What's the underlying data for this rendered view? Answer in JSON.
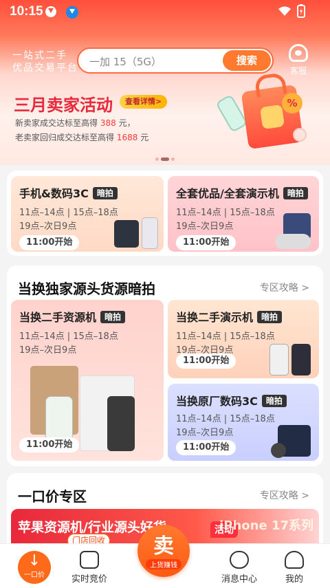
{
  "status_bar": {
    "time": "10:15"
  },
  "header": {
    "slogan_line1": "一站式二手",
    "slogan_line2": "优品交易平台",
    "search_value": "一加 15（5G）",
    "search_button": "搜索",
    "service_label": "客服"
  },
  "promo": {
    "title": "三月卖家活动",
    "detail_button": "查看详情>",
    "line1_prefix": "新卖家成交达标至高得",
    "line1_amount": "388",
    "line1_unit": "元，",
    "line2_prefix": "老卖家回归成交达标至高得",
    "line2_amount": "1688",
    "line2_unit": "元"
  },
  "auction_tiles": [
    {
      "title": "手机&数码3C",
      "tag": "暗拍",
      "time1": "11点–14点 | 15点–18点",
      "time2": "19点–次日9点",
      "start": "11:00开始"
    },
    {
      "title": "全套优品/全套演示机",
      "tag": "暗拍",
      "time1": "11点–14点 | 15点–18点",
      "time2": "19点–次日9点",
      "start": "11:00开始"
    }
  ],
  "exclusive": {
    "title": "当换独家源头货源暗拍",
    "more": "专区攻略 >",
    "tiles": [
      {
        "title": "当换二手资源机",
        "tag": "暗拍",
        "time1": "11点–14点 | 15点–18点",
        "time2": "19点–次日9点",
        "start": "11:00开始"
      },
      {
        "title": "当换二手演示机",
        "tag": "暗拍",
        "time1": "11点–14点 | 15点–18点",
        "time2": "19点–次日9点",
        "start": "11:00开始"
      },
      {
        "title": "当换原厂数码3C",
        "tag": "暗拍",
        "time1": "11点–14点 | 15点–18点",
        "time2": "19点–次日9点",
        "start": "11:00开始"
      }
    ]
  },
  "fixed_price": {
    "title": "一口价专区",
    "more": "专区攻略 >",
    "banner_title": "苹果资源机/行业源头好货",
    "banner_right": "iPhone 17系列",
    "activity_tag": "活动",
    "store_tag": "门店回收"
  },
  "nav": {
    "home": "一口价",
    "bidding": "实时竞价",
    "sell_big": "卖",
    "sell_small": "上货赚钱",
    "messages": "消息中心",
    "mine": "我的"
  }
}
